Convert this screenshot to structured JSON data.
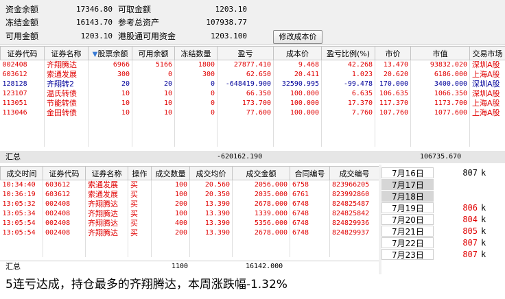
{
  "summary": {
    "labels": {
      "capital_balance": "资金余额",
      "withdrawable": "可取金额",
      "frozen": "冻结金额",
      "ref_total_assets": "参考总资产",
      "available": "可用金额",
      "hk_connect_available": "港股通可用资金"
    },
    "values": {
      "capital_balance": "17346.80",
      "withdrawable": "1203.10",
      "frozen": "16143.70",
      "ref_total_assets": "107938.77",
      "available": "1203.10",
      "hk_connect_available": "1203.100"
    },
    "modify_cost_button": "修改成本价"
  },
  "positions": {
    "sort_icon": "triangle-down",
    "headers": [
      "证券代码",
      "证券名称",
      "股票余额",
      "可用余额",
      "冻结数量",
      "盈亏",
      "成本价",
      "盈亏比例(%)",
      "市价",
      "市值",
      "交易市场"
    ],
    "rows": [
      {
        "code": "002408",
        "name": "齐翔腾达",
        "balance": "6966",
        "available": "5166",
        "frozen": "1800",
        "pnl": "27877.410",
        "cost": "9.468",
        "pnl_pct": "42.268",
        "price": "13.470",
        "value": "93832.020",
        "market": "深圳A股",
        "color": "red"
      },
      {
        "code": "603612",
        "name": "索通发展",
        "balance": "300",
        "available": "0",
        "frozen": "300",
        "pnl": "62.650",
        "cost": "20.411",
        "pnl_pct": "1.023",
        "price": "20.620",
        "value": "6186.000",
        "market": "上海A股",
        "color": "red"
      },
      {
        "code": "128128",
        "name": "齐翔转2",
        "balance": "20",
        "available": "20",
        "frozen": "0",
        "pnl": "-648419.900",
        "cost": "32590.995",
        "pnl_pct": "-99.478",
        "price": "170.000",
        "value": "3400.000",
        "market": "深圳A股",
        "color": "blue"
      },
      {
        "code": "123107",
        "name": "温氏转债",
        "balance": "10",
        "available": "10",
        "frozen": "0",
        "pnl": "66.350",
        "cost": "100.000",
        "pnl_pct": "6.635",
        "price": "106.635",
        "value": "1066.350",
        "market": "深圳A股",
        "color": "red"
      },
      {
        "code": "113051",
        "name": "节能转债",
        "balance": "10",
        "available": "10",
        "frozen": "0",
        "pnl": "173.700",
        "cost": "100.000",
        "pnl_pct": "17.370",
        "price": "117.370",
        "value": "1173.700",
        "market": "上海A股",
        "color": "red"
      },
      {
        "code": "113046",
        "name": "金田转债",
        "balance": "10",
        "available": "10",
        "frozen": "0",
        "pnl": "77.600",
        "cost": "100.000",
        "pnl_pct": "7.760",
        "price": "107.760",
        "value": "1077.600",
        "market": "上海A股",
        "color": "red"
      }
    ],
    "total": {
      "label": "汇总",
      "pnl": "-620162.190",
      "value": "106735.670"
    }
  },
  "trades": {
    "headers": [
      "成交时间",
      "证券代码",
      "证券名称",
      "操作",
      "成交数量",
      "成交均价",
      "成交金额",
      "合同编号",
      "成交编号"
    ],
    "rows": [
      {
        "time": "10:34:40",
        "code": "603612",
        "name": "索通发展",
        "op": "买",
        "qty": "100",
        "price": "20.560",
        "amount": "2056.000",
        "contract": "6758",
        "deal": "823966205"
      },
      {
        "time": "10:36:19",
        "code": "603612",
        "name": "索通发展",
        "op": "买",
        "qty": "100",
        "price": "20.350",
        "amount": "2035.000",
        "contract": "6761",
        "deal": "823992860"
      },
      {
        "time": "13:05:32",
        "code": "002408",
        "name": "齐翔腾达",
        "op": "买",
        "qty": "200",
        "price": "13.390",
        "amount": "2678.000",
        "contract": "6748",
        "deal": "824825487"
      },
      {
        "time": "13:05:34",
        "code": "002408",
        "name": "齐翔腾达",
        "op": "买",
        "qty": "100",
        "price": "13.390",
        "amount": "1339.000",
        "contract": "6748",
        "deal": "824825842"
      },
      {
        "time": "13:05:54",
        "code": "002408",
        "name": "齐翔腾达",
        "op": "买",
        "qty": "400",
        "price": "13.390",
        "amount": "5356.000",
        "contract": "6748",
        "deal": "824829936"
      },
      {
        "time": "13:05:54",
        "code": "002408",
        "name": "齐翔腾达",
        "op": "买",
        "qty": "200",
        "price": "13.390",
        "amount": "2678.000",
        "contract": "6748",
        "deal": "824829937"
      }
    ],
    "total": {
      "label": "汇总",
      "qty": "1100",
      "amount": "16142.000"
    }
  },
  "weekly": [
    {
      "date": "7月16日",
      "value": "807",
      "unit": "k",
      "color": "black",
      "shaded": false
    },
    {
      "date": "7月17日",
      "value": "",
      "unit": "",
      "color": "black",
      "shaded": true
    },
    {
      "date": "7月18日",
      "value": "",
      "unit": "",
      "color": "black",
      "shaded": true
    },
    {
      "date": "7月19日",
      "value": "806",
      "unit": "k",
      "color": "red",
      "shaded": false
    },
    {
      "date": "7月20日",
      "value": "804",
      "unit": "k",
      "color": "red",
      "shaded": false
    },
    {
      "date": "7月21日",
      "value": "805",
      "unit": "k",
      "color": "red",
      "shaded": false
    },
    {
      "date": "7月22日",
      "value": "807",
      "unit": "k",
      "color": "red",
      "shaded": false
    },
    {
      "date": "7月23日",
      "value": "807",
      "unit": "k",
      "color": "red",
      "shaded": false
    }
  ],
  "caption": "5连亏达成，持仓最多的齐翔腾达，本周涨跌幅-1.32%",
  "colors": {
    "gain": "#e00000",
    "loss": "#00009a"
  }
}
